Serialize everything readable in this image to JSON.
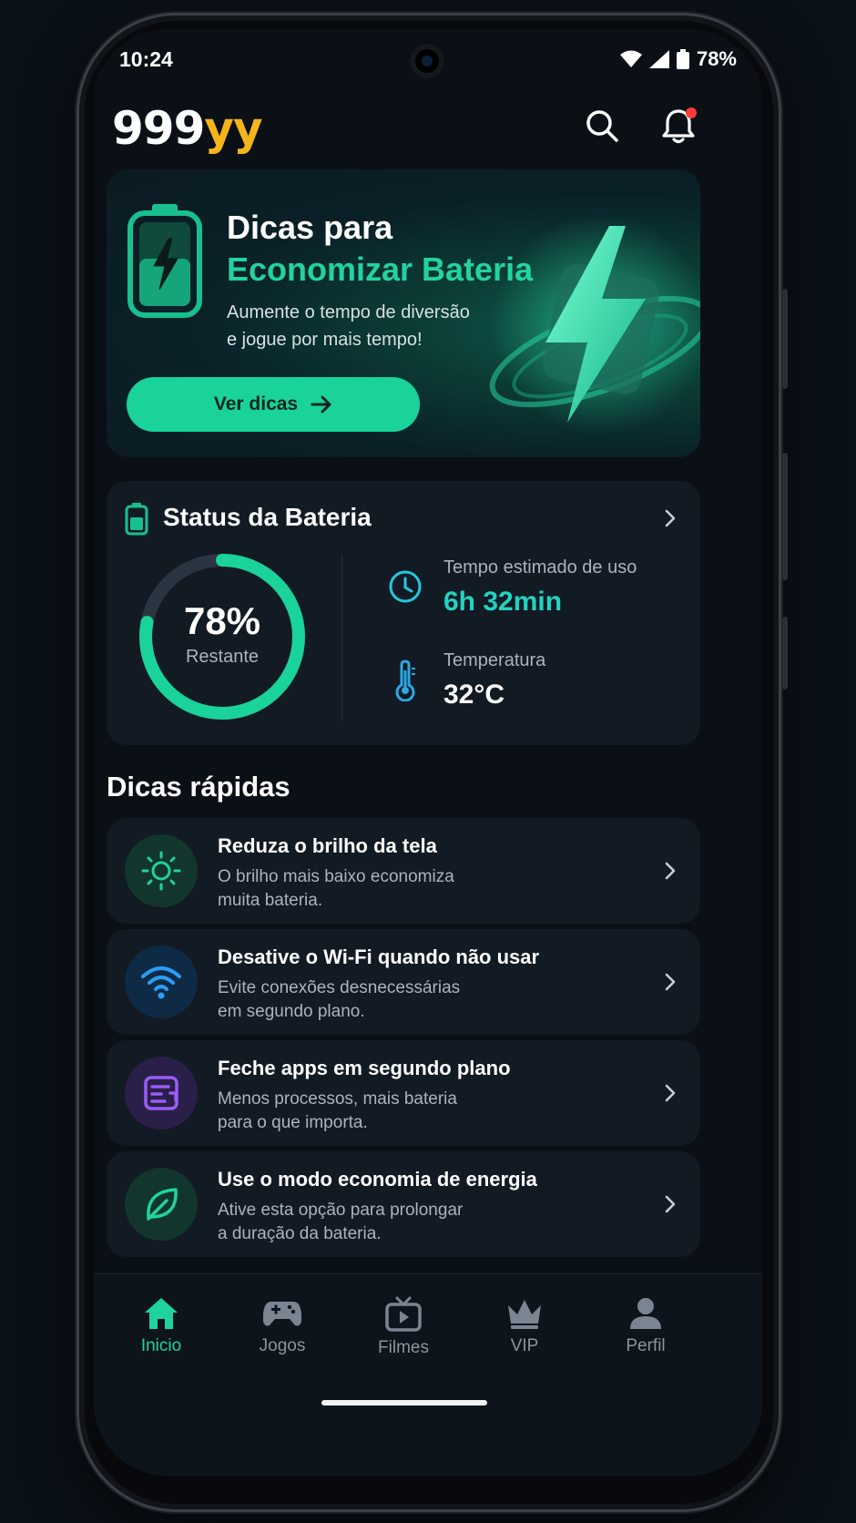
{
  "status_bar": {
    "time": "10:24",
    "battery": "78%"
  },
  "header": {
    "logo_part1": "999",
    "logo_part2": "yy"
  },
  "hero": {
    "title_line1": "Dicas para",
    "title_line2": "Economizar Bateria",
    "subtitle_line1": "Aumente o tempo de diversão",
    "subtitle_line2": "e jogue por mais tempo!",
    "button_label": "Ver dicas"
  },
  "battery_status": {
    "title": "Status da Bateria",
    "percent_text": "78%",
    "percent_value": 78,
    "remaining_label": "Restante",
    "time_label": "Tempo estimado de uso",
    "time_value": "6h 32min",
    "temp_label": "Temperatura",
    "temp_value": "32°C"
  },
  "quick_tips": {
    "title": "Dicas rápidas",
    "items": [
      {
        "title": "Reduza o brilho da tela",
        "desc1": "O brilho mais baixo economiza",
        "desc2": "muita bateria.",
        "icon": "sun-icon"
      },
      {
        "title": "Desative o Wi-Fi quando não usar",
        "desc1": "Evite conexões desnecessárias",
        "desc2": "em segundo plano.",
        "icon": "wifi-icon"
      },
      {
        "title": "Feche apps em segundo plano",
        "desc1": "Menos processos, mais bateria",
        "desc2": "para o que importa.",
        "icon": "apps-icon"
      },
      {
        "title": "Use o modo economia de energia",
        "desc1": "Ative esta opção para prolongar",
        "desc2": "a duração da bateria.",
        "icon": "leaf-icon"
      }
    ]
  },
  "bottom_nav": {
    "items": [
      {
        "label": "Inicio",
        "icon": "home-icon",
        "active": true
      },
      {
        "label": "Jogos",
        "icon": "gamepad-icon"
      },
      {
        "label": "Filmes",
        "icon": "tv-icon"
      },
      {
        "label": "VIP",
        "icon": "crown-icon"
      },
      {
        "label": "Perfil",
        "icon": "user-icon"
      }
    ]
  },
  "colors": {
    "accent": "#19d39b",
    "logo_yellow": "#f4b51b",
    "background": "#0b1017",
    "card": "#121a24"
  }
}
